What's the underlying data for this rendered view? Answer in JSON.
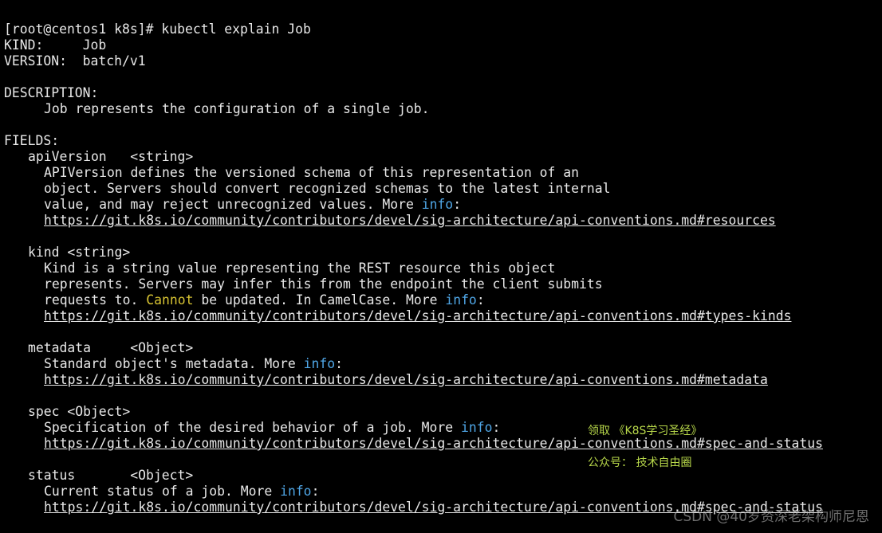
{
  "terminal": {
    "prompt": "[root@centos1 k8s]# kubectl explain Job",
    "kind_line": "KIND:     Job",
    "version_line": "VERSION:  batch/v1",
    "description_heading": "DESCRIPTION:",
    "description_text": "Job represents the configuration of a single job.",
    "fields_heading": "FIELDS:",
    "more": "More",
    "info": "info",
    "fields": {
      "apiVersion": {
        "header": "apiVersion   <string>",
        "line1": "APIVersion defines the versioned schema of this representation of an",
        "line2": "object. Servers should convert recognized schemas to the latest internal",
        "line3_prefix": "value, and may reject unrecognized values.",
        "url": "https://git.k8s.io/community/contributors/devel/sig-architecture/api-conventions.md#resources"
      },
      "kind": {
        "header": "kind <string>",
        "line1": "Kind is a string value representing the REST resource this object",
        "line2": "represents. Servers may infer this from the endpoint the client submits",
        "line3_a": "requests to.",
        "cannot": "Cannot",
        "line3_b": "be updated. In CamelCase.",
        "url": "https://git.k8s.io/community/contributors/devel/sig-architecture/api-conventions.md#types-kinds"
      },
      "metadata": {
        "header": "metadata     <Object>",
        "line1_prefix": "Standard object's metadata.",
        "url": "https://git.k8s.io/community/contributors/devel/sig-architecture/api-conventions.md#metadata"
      },
      "spec": {
        "header": "spec <Object>",
        "line1_prefix": "Specification of the desired behavior of a job.",
        "url": "https://git.k8s.io/community/contributors/devel/sig-architecture/api-conventions.md#spec-and-status"
      },
      "status": {
        "header": "status       <Object>",
        "line1_prefix": "Current status of a job.",
        "url": "https://git.k8s.io/community/contributors/devel/sig-architecture/api-conventions.md#spec-and-status"
      }
    }
  },
  "overlay": {
    "line1": "领取 《K8S学习圣经》",
    "line2": "公众号： 技术自由圈"
  },
  "watermark": "CSDN @40岁资深老架构师尼恩",
  "colors": {
    "background": "#000000",
    "text": "#e8e8e8",
    "info": "#4fa6e6",
    "cannot": "#d8c433",
    "overlay": "#b8d84a"
  }
}
